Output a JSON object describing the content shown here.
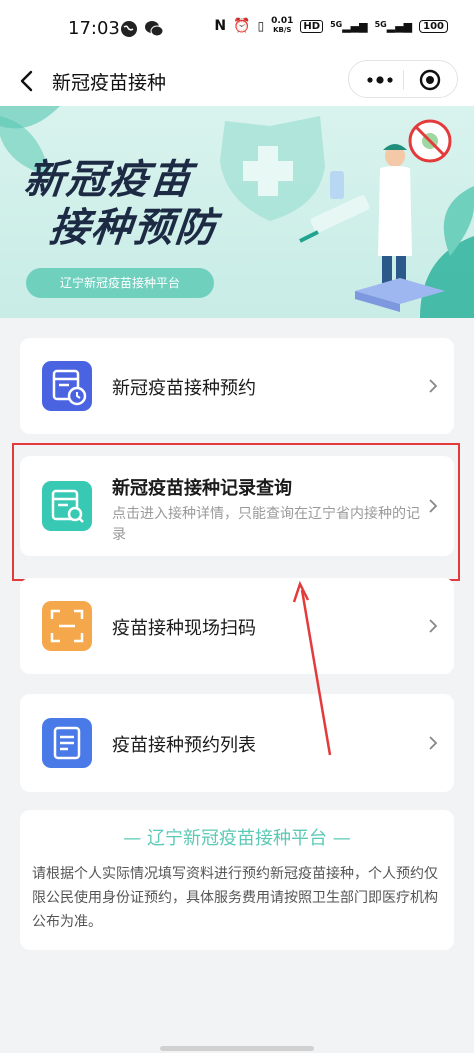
{
  "status_bar": {
    "time": "17:03",
    "network_speed_value": "0.01",
    "network_speed_unit": "KB/S",
    "hd_badge": "HD",
    "signal_1": "5G",
    "signal_2": "5G",
    "battery": "100"
  },
  "nav": {
    "title": "新冠疫苗接种"
  },
  "banner": {
    "headline_line1": "新冠疫苗",
    "headline_line2": "接种预防",
    "subtitle": "辽宁新冠疫苗接种平台"
  },
  "menu": [
    {
      "title": "新冠疫苗接种预约"
    },
    {
      "title": "新冠疫苗接种记录查询",
      "description": "点击进入接种详情，只能查询在辽宁省内接种的记录"
    },
    {
      "title": "疫苗接种现场扫码"
    },
    {
      "title": "疫苗接种预约列表"
    }
  ],
  "info": {
    "title": "— 辽宁新冠疫苗接种平台 —",
    "text": "请根据个人实际情况填写资料进行预约新冠疫苗接种，个人预约仅限公民使用身份证预约，具体服务费用请按照卫生部门即医疗机构公布为准。"
  },
  "colors": {
    "accent": "#5cc9b6",
    "highlight": "#e33b3b",
    "icon_blue": "#4a63e0",
    "icon_teal": "#38c9b5",
    "icon_orange": "#f5a74c"
  }
}
